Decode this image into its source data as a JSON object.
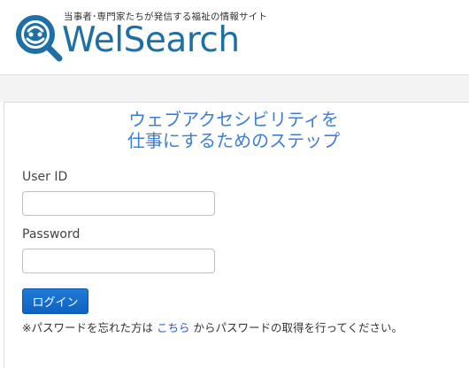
{
  "header": {
    "tagline": "当事者･専門家たちが発信する福祉の情報サイト",
    "brand": "WelSearch",
    "brand_color": "#1e6fa6"
  },
  "main": {
    "heading_line1": "ウェブアクセシビリティを",
    "heading_line2": "仕事にするためのステップ",
    "heading_color": "#3d7fd6",
    "userid_label": "User ID",
    "userid_value": "",
    "password_label": "Password",
    "password_value": "",
    "login_button": "ログイン",
    "login_button_color": "#1569c7",
    "note_prefix": "※パスワードを忘れた方は ",
    "note_link": "こちら",
    "note_suffix": " からパスワードの取得を行ってください。"
  }
}
